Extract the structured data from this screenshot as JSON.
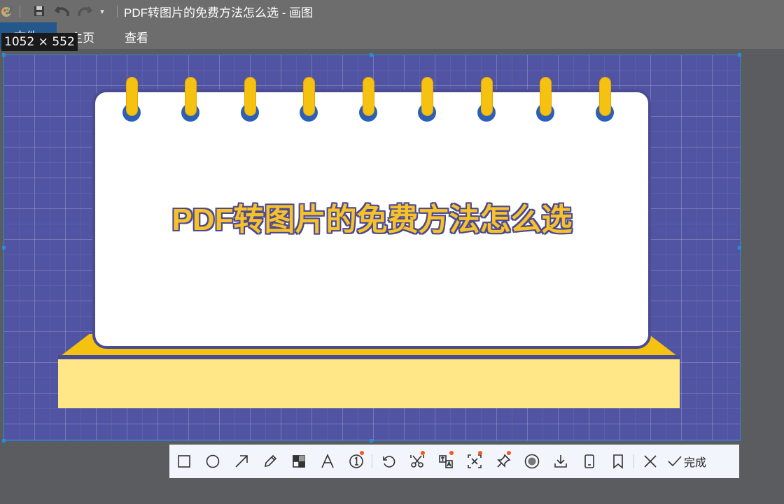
{
  "window": {
    "title": "PDF转图片的免费方法怎么选 - 画图"
  },
  "quick_access": {
    "save_icon": "save-icon",
    "undo_icon": "undo-icon",
    "redo_icon": "redo-icon",
    "customize_icon": "dropdown-arrow-icon"
  },
  "menu": {
    "file_label": "文件",
    "home_label": "主页",
    "view_label": "查看"
  },
  "selection": {
    "dimensions": "1052 × 552"
  },
  "canvas": {
    "headline": "PDF转图片的免费方法怎么选",
    "colors": {
      "background": "#5154a3",
      "ring": "#f5c211",
      "ring_hole": "#2c5fb8",
      "headline": "#f7c12a",
      "base_front": "#ffe788"
    }
  },
  "toolbar": {
    "tools": [
      {
        "name": "rectangle-tool",
        "icon": "rectangle-icon"
      },
      {
        "name": "ellipse-tool",
        "icon": "circle-icon"
      },
      {
        "name": "arrow-tool",
        "icon": "arrow-icon"
      },
      {
        "name": "pen-tool",
        "icon": "pencil-icon"
      },
      {
        "name": "mosaic-tool",
        "icon": "mosaic-icon"
      },
      {
        "name": "text-tool",
        "icon": "text-icon"
      },
      {
        "name": "number-tool",
        "icon": "numbered-marker-icon"
      },
      {
        "name": "undo-tool",
        "icon": "undo-icon"
      },
      {
        "name": "cutout-tool",
        "icon": "scissors-icon"
      },
      {
        "name": "translate-tool",
        "icon": "translate-icon"
      },
      {
        "name": "ocr-tool",
        "icon": "text-recognition-icon"
      },
      {
        "name": "pin-tool",
        "icon": "pin-icon"
      },
      {
        "name": "record-tool",
        "icon": "record-icon"
      },
      {
        "name": "download-tool",
        "icon": "download-icon"
      },
      {
        "name": "phone-tool",
        "icon": "phone-icon"
      },
      {
        "name": "bookmark-tool",
        "icon": "bookmark-icon"
      },
      {
        "name": "close-tool",
        "icon": "close-icon"
      }
    ],
    "done_label": "完成"
  }
}
